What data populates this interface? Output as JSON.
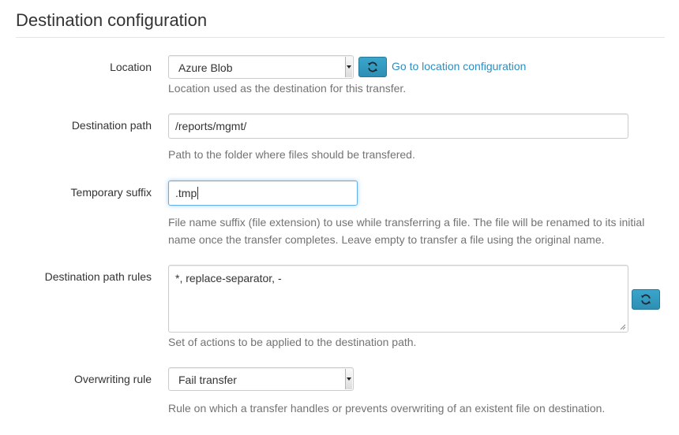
{
  "section": {
    "title": "Destination configuration"
  },
  "location": {
    "label": "Location",
    "selected": "Azure Blob",
    "link": "Go to location configuration",
    "help": "Location used as the destination for this transfer."
  },
  "destination_path": {
    "label": "Destination path",
    "value": "/reports/mgmt/",
    "help": "Path to the folder where files should be transfered."
  },
  "temporary_suffix": {
    "label": "Temporary suffix",
    "value": ".tmp",
    "help_line1": "File name suffix (file extension) to use while transferring a file. The file will be renamed to its initial",
    "help_line2": "name once the transfer completes. Leave empty to transfer a file using the original name."
  },
  "destination_path_rules": {
    "label": "Destination path rules",
    "value": "*, replace-separator, -",
    "help": "Set of actions to be applied to the destination path."
  },
  "overwriting_rule": {
    "label": "Overwriting rule",
    "selected": "Fail transfer",
    "help": "Rule on which a transfer handles or prevents overwriting of an existent file on destination."
  },
  "colors": {
    "accent_button": "#3aa5cc",
    "link": "#2a8fc1",
    "help_text": "#737373",
    "focus_border": "#66afe9"
  },
  "icons": {
    "refresh": "refresh-icon",
    "dropdown": "chevron-down-icon"
  }
}
